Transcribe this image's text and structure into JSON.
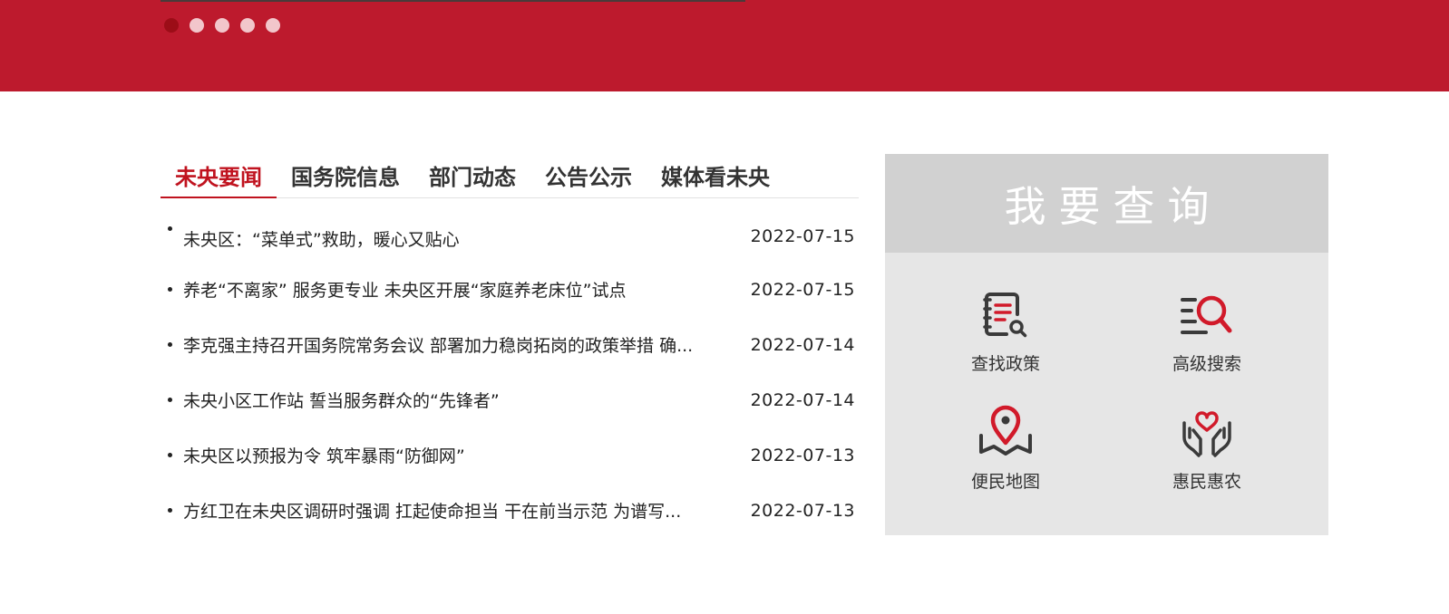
{
  "banner": {
    "slides": 5,
    "active_slide": 1
  },
  "news": {
    "tabs": [
      {
        "label": "未央要闻"
      },
      {
        "label": "国务院信息"
      },
      {
        "label": "部门动态"
      },
      {
        "label": "公告公示"
      },
      {
        "label": "媒体看未央"
      }
    ],
    "active_tab": 0,
    "items": [
      {
        "title": "未央区：“菜单式”救助，暖心又贴心",
        "date": "2022-07-15"
      },
      {
        "title": "养老“不离家” 服务更专业 未央区开展“家庭养老床位”试点",
        "date": "2022-07-15"
      },
      {
        "title": "李克强主持召开国务院常务会议 部署加力稳岗拓岗的政策举措 确...",
        "date": "2022-07-14"
      },
      {
        "title": "未央小区工作站 誓当服务群众的“先锋者”",
        "date": "2022-07-14"
      },
      {
        "title": "未央区以预报为令 筑牢暴雨“防御网”",
        "date": "2022-07-13"
      },
      {
        "title": "方红卫在未央区调研时强调 扛起使命担当 干在前当示范 为谱写...",
        "date": "2022-07-13"
      }
    ]
  },
  "query": {
    "title": "我要查询",
    "items": [
      {
        "label": "查找政策",
        "icon": "policy-search-icon"
      },
      {
        "label": "高级搜索",
        "icon": "advanced-search-icon"
      },
      {
        "label": "便民地图",
        "icon": "map-pin-icon"
      },
      {
        "label": "惠民惠农",
        "icon": "heart-hands-icon"
      }
    ]
  },
  "colors": {
    "brand_red": "#bd1a2d",
    "tab_active": "#c0131f",
    "icon_dark": "#3a3a3a",
    "icon_red": "#d11a2a"
  }
}
